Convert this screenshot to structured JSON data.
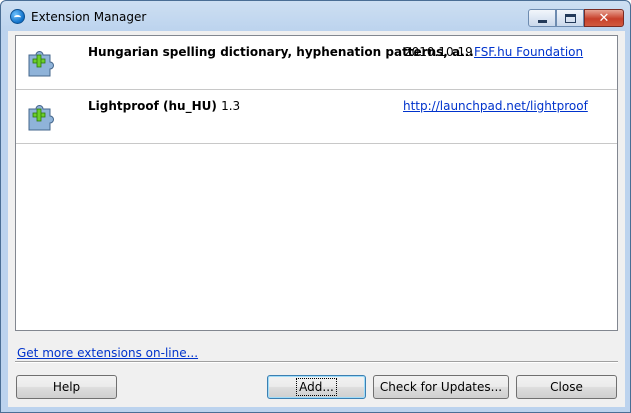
{
  "window": {
    "title": "Extension Manager",
    "icons": {
      "app": "openoffice-icon",
      "minimize": "minimize-icon",
      "maximize": "maximize-icon",
      "close": "close-icon"
    },
    "close_glyph": "✕"
  },
  "extensions": [
    {
      "name": "Hungarian spelling dictionary, hyphenation patterns, a...",
      "version": "",
      "date": "2010.10.19",
      "link": "FSF.hu Foundation",
      "icon": "puzzle-extension-icon"
    },
    {
      "name": "Lightproof (hu_HU)",
      "version": "1.3",
      "date": "",
      "link": "http://launchpad.net/lightproof",
      "icon": "puzzle-extension-icon"
    }
  ],
  "more_link": "Get more extensions on-line...",
  "buttons": {
    "help": "Help",
    "add": "Add...",
    "check_updates": "Check for Updates...",
    "close": "Close"
  },
  "colors": {
    "link": "#0033cc",
    "puzzle": "#8fb3d9",
    "plus": "#6ccf2a"
  }
}
